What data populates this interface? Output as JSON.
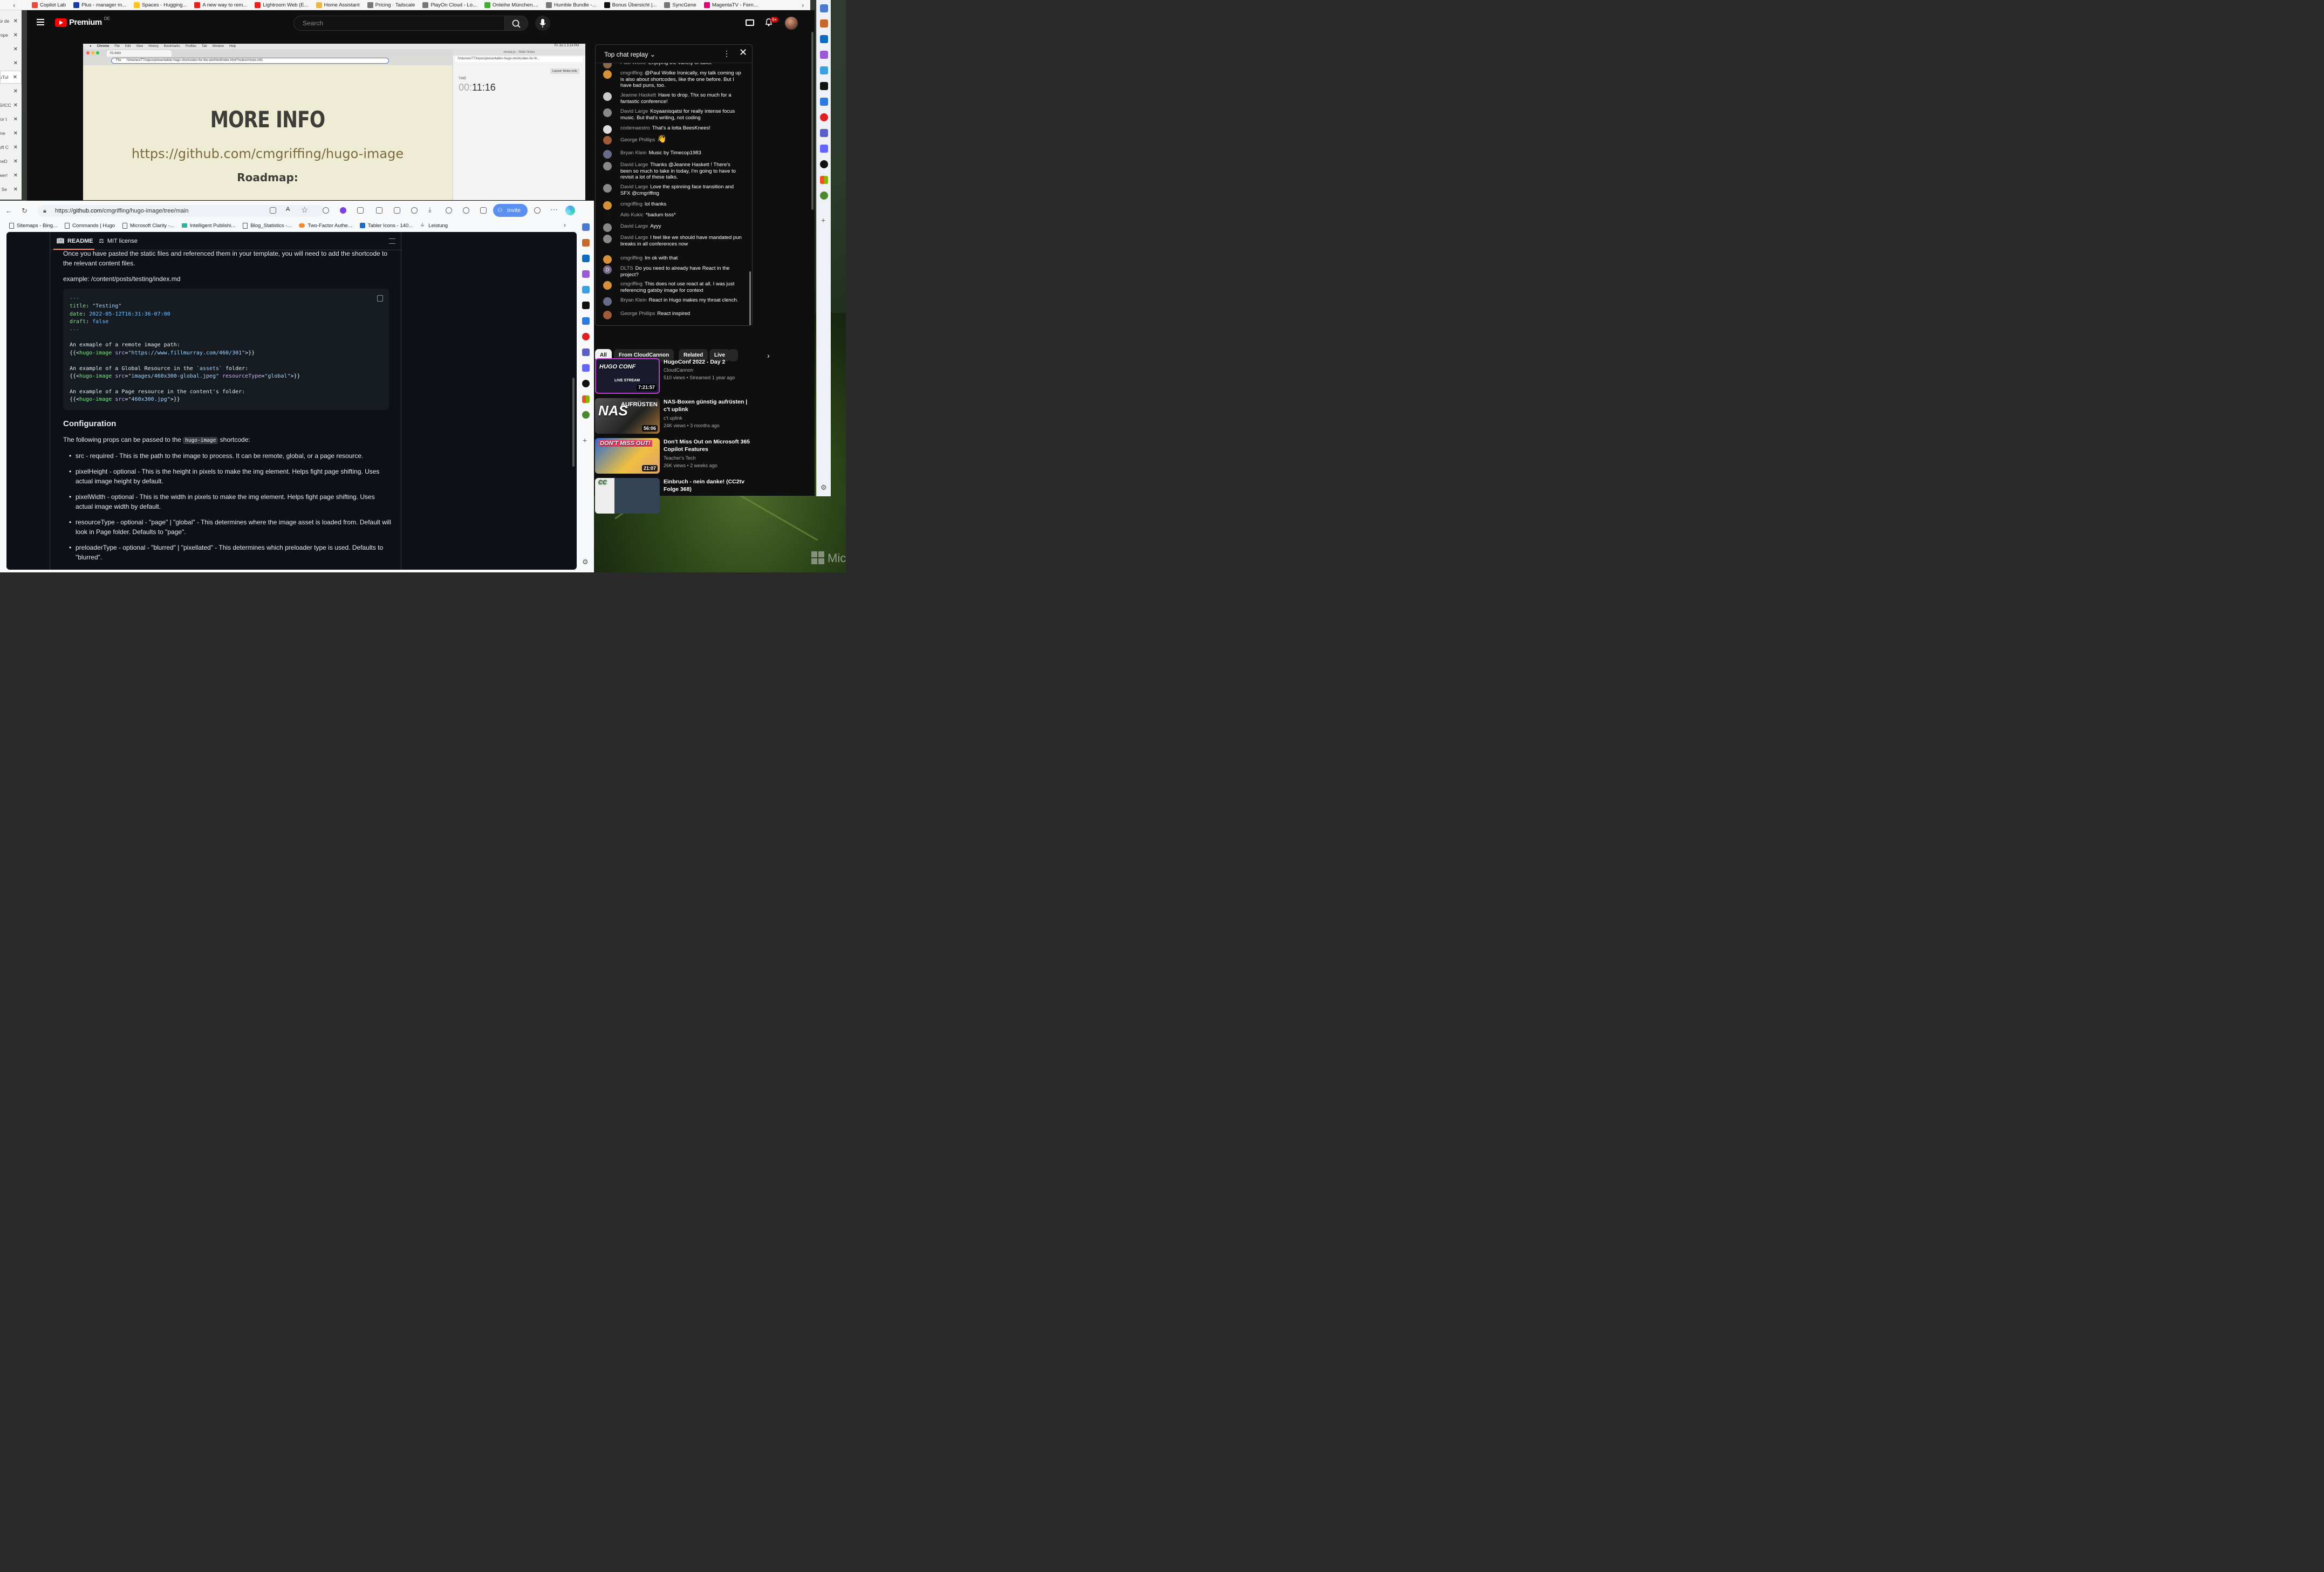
{
  "top_bookmarks": [
    {
      "label": "Copilot Lab",
      "color": "#e74c3c"
    },
    {
      "label": "Plus - manager m...",
      "color": "#1a3a9c"
    },
    {
      "label": "Spaces - Hugging...",
      "color": "#f7c325"
    },
    {
      "label": "A new way to rem...",
      "color": "#e52222"
    },
    {
      "label": "Lightroom Web (E...",
      "color": "#e52222"
    },
    {
      "label": "Home Assistant",
      "color": "#e8b84a"
    },
    {
      "label": "Pricing · Tailscale",
      "color": "#777777"
    },
    {
      "label": "PlayOn Cloud - Lo...",
      "color": "#777777"
    },
    {
      "label": "Onleihe München....",
      "color": "#4aa83a"
    },
    {
      "label": "Humble Bundle -...",
      "color": "#777777"
    },
    {
      "label": "Bonus Übersicht |...",
      "color": "#111111"
    },
    {
      "label": "SyncGene",
      "color": "#777777"
    },
    {
      "label": "MagentaTV - Fern...",
      "color": "#e20074"
    }
  ],
  "left_tabs": [
    "ür de",
    "rope",
    "",
    "",
    "uTul",
    "",
    "S/ICC",
    "for t",
    "me",
    "oft C",
    "neD",
    "wer!",
    "| Se"
  ],
  "youtube": {
    "logo_word": "Premium",
    "logo_country": "DE",
    "search_placeholder": "Search",
    "notification_badge": "9+",
    "video": {
      "mac_menu": [
        "Chrome",
        "File",
        "Edit",
        "View",
        "History",
        "Bookmarks",
        "Profiles",
        "Tab",
        "Window",
        "Help"
      ],
      "mac_clock": "Fri Jul 1 3:14 PM",
      "tab_title": "01-intro",
      "url": "/Volumes/T7/repos/presentation-hugo-shortcodes-for-the-win/html/index.html?notes#/more-info",
      "url_prefix": "File",
      "slide_heading": "MORE INFO",
      "slide_link": "https://github.com/cmgriffing/hugo-image",
      "slide_next": "Roadmap:",
      "notes_title": "reveal.js - Slide Notes",
      "notes_url": "/Volumes/T7/repos/presentation-hugo-shortcodes-for-th...",
      "layout_btn": "Layout: Notes only",
      "time_label": "TIME",
      "time_dim": "00:",
      "time_value": "11:16"
    },
    "chat": {
      "title": "Top chat replay",
      "messages": [
        {
          "author": "Paul Wolke",
          "text": "Enjoying the variety of talks.",
          "color": "#8a6a4a"
        },
        {
          "author": "cmgriffing",
          "text": "@Paul Wolke Ironically, my talk coming up is also about shortcodes, like the one before. But I have bad puns, too.",
          "color": "#d6903a"
        },
        {
          "author": "Jeanne Haskett",
          "text": "Have to drop. Thx so much for a fantastic conference!",
          "color": "#c9c9c9"
        },
        {
          "author": "David Large",
          "text": "Koyaanisqatsi for really intense focus music. But that's writing, not coding",
          "color": "#888888"
        },
        {
          "author": "codemaestro",
          "text": "That's a lotta BeesKnees!",
          "color": "#dddddd"
        },
        {
          "author": "George Phillips",
          "text": "👋",
          "color": "#a05a3a"
        },
        {
          "author": "Bryan Klein",
          "text": "Music by Timecop1983",
          "color": "#6a6a8a"
        },
        {
          "author": "David Large",
          "text": "Thanks @Jeanne Haskett ! There's been so much to take in today, I'm going to have to revisit a lot of these talks.",
          "color": "#888888"
        },
        {
          "author": "David Large",
          "text": "Love the spinning face transition and SFX @cmgriffing",
          "color": "#888888"
        },
        {
          "author": "cmgriffing",
          "text": "lol thanks",
          "color": "#d6903a"
        },
        {
          "author": "Ado Kukic",
          "text": "*badum tsss*",
          "color": "#111111"
        },
        {
          "author": "David Large",
          "text": "Ayyy",
          "color": "#888888"
        },
        {
          "author": "David Large",
          "text": "I feel like we should have mandated pun breaks in all conferences now",
          "color": "#888888"
        },
        {
          "author": "cmgriffing",
          "text": "Im ok with that",
          "color": "#d6903a"
        },
        {
          "author": "DLTS",
          "text": "Do you need to already have React in the project?",
          "color": "#7a6a8a",
          "initial": "D"
        },
        {
          "author": "cmgriffing",
          "text": "This does not use react at all. I was just referencing gatsby image for context",
          "color": "#d6903a"
        },
        {
          "author": "Bryan Klein",
          "text": "React in Hugo makes my throat clench.",
          "color": "#6a6a8a"
        },
        {
          "author": "George Phillips",
          "text": "React inspired",
          "color": "#a05a3a"
        }
      ]
    },
    "chips": [
      "All",
      "From CloudCannon",
      "Related",
      "Live"
    ],
    "related": [
      {
        "title": "HugoConf 2022 - Day 2",
        "channel": "CloudCannon",
        "meta": "510 views • Streamed 1 year ago",
        "duration": "7:21:57",
        "thumb_text": "HUGO CONF",
        "thumb_sub": "LIVE STREAM"
      },
      {
        "title": "NAS-Boxen günstig aufrüsten | c't uplink",
        "channel": "c't uplink",
        "meta": "24K views • 3 months ago",
        "duration": "56:06",
        "thumb_text": "NAS",
        "thumb_sub": "AUFRÜSTEN"
      },
      {
        "title": "Don't Miss Out on Microsoft 365 Copilot Features",
        "channel": "Teacher's Tech",
        "meta": "26K views • 2 weeks ago",
        "duration": "21:07",
        "thumb_text": "DON'T MISS OUT!",
        "thumb_sub": ""
      },
      {
        "title": "Einbruch - nein danke! (CC2tv Folge 368)",
        "channel": "",
        "meta": "",
        "duration": "",
        "thumb_text": "CC",
        "thumb_sub": ""
      }
    ]
  },
  "edge": {
    "url_prefix": "https://",
    "url_host": "github.com",
    "url_path": "/cmgriffing/hugo-image/tree/main",
    "invite_label": "Invite",
    "bookmarks": [
      "Sitemaps - Bing...",
      "Commands | Hugo",
      "Microsoft Clarity -...",
      "Intelligent Publishi...",
      "Blog_Statistics -...",
      "Two-Factor Authe...",
      "Tabler Icons - 140...",
      "Leistung"
    ],
    "readme_tab": "README",
    "license_tab": "MIT license",
    "p1": "Once you have pasted the static files and referenced them in your template, you will need to add the shortcode to the relevant content files.",
    "p2": "example: /content/posts/testing/index.md",
    "code": {
      "sep": "---",
      "title_key": "title",
      "title_val": "\"Testing\"",
      "date_key": "date",
      "date_val": "2022-05-12T16:31:36-07:00",
      "draft_key": "draft",
      "draft_val": "false",
      "c1": "An exmaple of a remote image path:",
      "l1_open": "{{<",
      "l1_tag": "hugo-image",
      "l1_attr": "src",
      "l1_val": "\"https://www.fillmurray.com/460/301\"",
      "l1_close": ">}}",
      "c2a": "An example of a Global Resource in the ",
      "c2b": "`assets`",
      "c2c": " folder:",
      "l2_val": "\"images/460x300-global.jpeg\"",
      "l2_attr2": "resourceType",
      "l2_val2": "\"global\"",
      "c3": "An example of a Page resource in the content's folder:",
      "l3_val": "\"460x300.jpg\""
    },
    "config_heading": "Configuration",
    "config_intro_a": "The following props can be passed to the ",
    "config_intro_code": "hugo-image",
    "config_intro_b": " shortcode:",
    "props": [
      "src - required - This is the path to the image to process. It can be remote, global, or a page resource.",
      "pixelHeight - optional - This is the height in pixels to make the img element. Helps fight page shifting. Uses actual image height by default.",
      "pixelWidth - optional - This is the width in pixels to make the img element. Helps fight page shifting. Uses actual image width by default.",
      "resourceType - optional - \"page\" | \"global\" - This determines where the image asset is loaded from. Default will look in Page folder. Defaults to \"page\".",
      "preloaderType - optional - \"blurred\" | \"pixellated\" - This determines which preloader type is used. Defaults to \"blurred\"."
    ]
  },
  "desktop_watermark": "Mic"
}
